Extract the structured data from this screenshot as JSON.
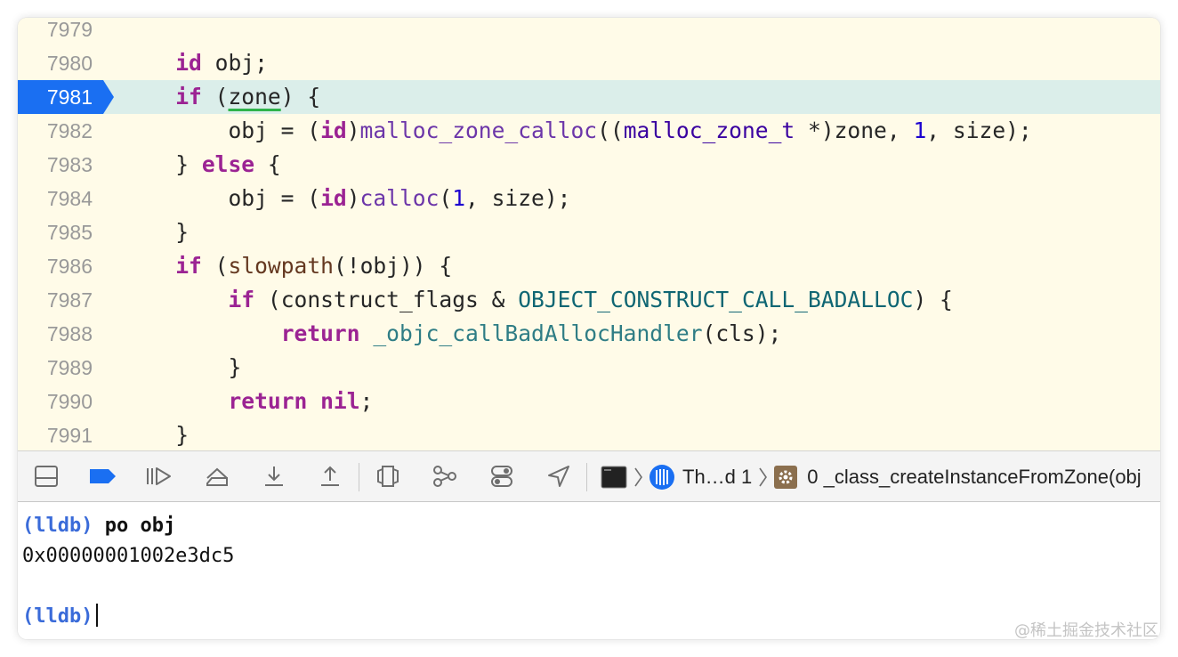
{
  "editor": {
    "current_line": "7981",
    "lines": [
      {
        "num": "7979",
        "tokens": []
      },
      {
        "num": "7980",
        "tokens": [
          {
            "t": "    "
          },
          {
            "t": "id",
            "c": "kw"
          },
          {
            "t": " obj;"
          }
        ]
      },
      {
        "num": "7981",
        "tokens": [
          {
            "t": "    "
          },
          {
            "t": "if",
            "c": "kw"
          },
          {
            "t": " ("
          },
          {
            "t": "zone",
            "c": "warn"
          },
          {
            "t": ") {"
          }
        ]
      },
      {
        "num": "7982",
        "tokens": [
          {
            "t": "        obj = ("
          },
          {
            "t": "id",
            "c": "kw"
          },
          {
            "t": ")"
          },
          {
            "t": "malloc_zone_calloc",
            "c": "func"
          },
          {
            "t": "(("
          },
          {
            "t": "malloc_zone_t",
            "c": "type"
          },
          {
            "t": " *)zone, "
          },
          {
            "t": "1",
            "c": "num"
          },
          {
            "t": ", size);"
          }
        ]
      },
      {
        "num": "7983",
        "tokens": [
          {
            "t": "    } "
          },
          {
            "t": "else",
            "c": "kw"
          },
          {
            "t": " {"
          }
        ]
      },
      {
        "num": "7984",
        "tokens": [
          {
            "t": "        obj = ("
          },
          {
            "t": "id",
            "c": "kw"
          },
          {
            "t": ")"
          },
          {
            "t": "calloc",
            "c": "func"
          },
          {
            "t": "("
          },
          {
            "t": "1",
            "c": "num"
          },
          {
            "t": ", size);"
          }
        ]
      },
      {
        "num": "7985",
        "tokens": [
          {
            "t": "    }"
          }
        ]
      },
      {
        "num": "7986",
        "tokens": [
          {
            "t": "    "
          },
          {
            "t": "if",
            "c": "kw"
          },
          {
            "t": " ("
          },
          {
            "t": "slowpath",
            "c": "slow"
          },
          {
            "t": "(!obj)) {"
          }
        ]
      },
      {
        "num": "7987",
        "tokens": [
          {
            "t": "        "
          },
          {
            "t": "if",
            "c": "kw"
          },
          {
            "t": " (construct_flags & "
          },
          {
            "t": "OBJECT_CONSTRUCT_CALL_BADALLOC",
            "c": "macro"
          },
          {
            "t": ") {"
          }
        ]
      },
      {
        "num": "7988",
        "tokens": [
          {
            "t": "            "
          },
          {
            "t": "return",
            "c": "kw"
          },
          {
            "t": " "
          },
          {
            "t": "_objc_callBadAllocHandler",
            "c": "fn2"
          },
          {
            "t": "(cls);"
          }
        ]
      },
      {
        "num": "7989",
        "tokens": [
          {
            "t": "        }"
          }
        ]
      },
      {
        "num": "7990",
        "tokens": [
          {
            "t": "        "
          },
          {
            "t": "return",
            "c": "kw"
          },
          {
            "t": " "
          },
          {
            "t": "nil",
            "c": "kw"
          },
          {
            "t": ";"
          }
        ]
      },
      {
        "num": "7991",
        "tokens": [
          {
            "t": "    }"
          }
        ]
      }
    ]
  },
  "debugbar": {
    "buttons": [
      {
        "name": "hide-debug-area-button",
        "icon": "panel-bottom-icon"
      },
      {
        "name": "breakpoints-toggle-button",
        "icon": "breakpoint-icon"
      },
      {
        "name": "continue-button",
        "icon": "continue-icon"
      },
      {
        "name": "step-over-button",
        "icon": "step-over-icon"
      },
      {
        "name": "step-into-button",
        "icon": "step-into-icon"
      },
      {
        "name": "step-out-button",
        "icon": "step-out-icon"
      },
      {
        "name": "debug-view-hierarchy-button",
        "icon": "view-hierarchy-icon"
      },
      {
        "name": "debug-memory-graph-button",
        "icon": "memory-graph-icon"
      },
      {
        "name": "environment-overrides-button",
        "icon": "toggles-icon"
      },
      {
        "name": "simulate-location-button",
        "icon": "location-arrow-icon"
      }
    ],
    "breadcrumbs": {
      "thread": "Th…d 1",
      "frame": "0 _class_createInstanceFromZone(obj"
    },
    "accent": "#1a6ff2"
  },
  "console": {
    "prompt": "(lldb)",
    "command": "po obj",
    "output": "0x00000001002e3dc5"
  },
  "watermark": "@稀土掘金技术社区"
}
